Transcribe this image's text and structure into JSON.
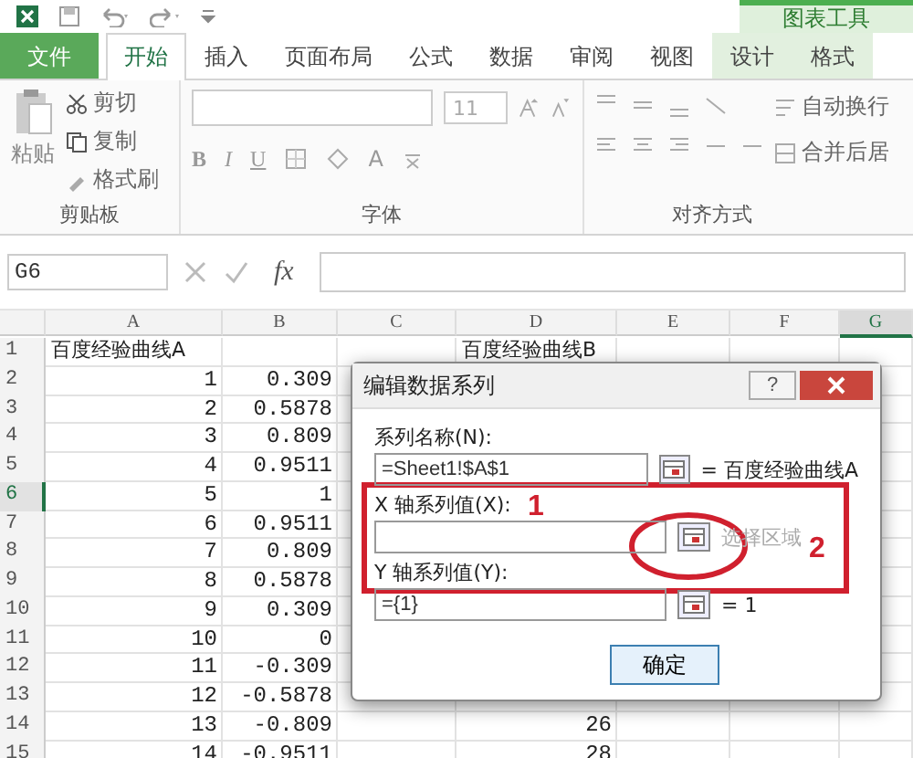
{
  "contextual_tab_group": "图表工具",
  "tabs": [
    {
      "label": "文件",
      "kind": "file",
      "selected": false
    },
    {
      "label": "开始",
      "kind": "normal",
      "selected": true
    },
    {
      "label": "插入",
      "kind": "normal",
      "selected": false
    },
    {
      "label": "页面布局",
      "kind": "normal",
      "selected": false
    },
    {
      "label": "公式",
      "kind": "normal",
      "selected": false
    },
    {
      "label": "数据",
      "kind": "normal",
      "selected": false
    },
    {
      "label": "审阅",
      "kind": "normal",
      "selected": false
    },
    {
      "label": "视图",
      "kind": "normal",
      "selected": false
    },
    {
      "label": "设计",
      "kind": "contextual",
      "selected": false
    },
    {
      "label": "格式",
      "kind": "contextual",
      "selected": false
    }
  ],
  "ribbon": {
    "clipboard": {
      "paste": "粘贴",
      "cut": "剪切",
      "copy": "复制",
      "format_painter": "格式刷",
      "label": "剪贴板"
    },
    "font": {
      "font_size": "11",
      "bold": "B",
      "italic": "I",
      "underline": "U",
      "font_color": "A",
      "label": "字体"
    },
    "alignment": {
      "wrap_text": "自动换行",
      "merge": "合并后居",
      "label": "对齐方式"
    }
  },
  "name_box": "G6",
  "formula_bar": {
    "fx": "fx"
  },
  "sheet": {
    "columns": [
      {
        "label": "A",
        "selected": false
      },
      {
        "label": "B",
        "selected": false
      },
      {
        "label": "C",
        "selected": false
      },
      {
        "label": "D",
        "selected": false
      },
      {
        "label": "E",
        "selected": false
      },
      {
        "label": "F",
        "selected": false
      },
      {
        "label": "G",
        "selected": true
      }
    ],
    "rows": [
      {
        "number": "1",
        "selected": false,
        "cells": [
          "百度经验曲线A",
          "",
          "",
          "百度经验曲线B"
        ]
      },
      {
        "number": "2",
        "selected": false,
        "cells": [
          "1",
          "0.309"
        ]
      },
      {
        "number": "3",
        "selected": false,
        "cells": [
          "2",
          "0.5878"
        ]
      },
      {
        "number": "4",
        "selected": false,
        "cells": [
          "3",
          "0.809"
        ]
      },
      {
        "number": "5",
        "selected": false,
        "cells": [
          "4",
          "0.9511"
        ]
      },
      {
        "number": "6",
        "selected": true,
        "cells": [
          "5",
          "1"
        ]
      },
      {
        "number": "7",
        "selected": false,
        "cells": [
          "6",
          "0.9511"
        ]
      },
      {
        "number": "8",
        "selected": false,
        "cells": [
          "7",
          "0.809"
        ]
      },
      {
        "number": "9",
        "selected": false,
        "cells": [
          "8",
          "0.5878"
        ]
      },
      {
        "number": "10",
        "selected": false,
        "cells": [
          "9",
          "0.309"
        ]
      },
      {
        "number": "11",
        "selected": false,
        "cells": [
          "10",
          "0"
        ]
      },
      {
        "number": "12",
        "selected": false,
        "cells": [
          "11",
          "-0.309"
        ]
      },
      {
        "number": "13",
        "selected": false,
        "cells": [
          "12",
          "-0.5878"
        ]
      },
      {
        "number": "14",
        "selected": false,
        "cells": [
          "13",
          "-0.809",
          "",
          "26"
        ]
      },
      {
        "number": "15",
        "selected": false,
        "cells": [
          "14",
          "-0.9511",
          "",
          "28"
        ]
      }
    ]
  },
  "dialog": {
    "title": "编辑数据系列",
    "help": "?",
    "fields": [
      {
        "label": "系列名称(N):",
        "value": "=Sheet1!$A$1",
        "result": "= 百度经验曲线A",
        "result_muted": false
      },
      {
        "label": "X 轴系列值(X):",
        "result": "选择区域",
        "result_muted": true
      },
      {
        "label": "Y 轴系列值(Y):",
        "value": "={1}",
        "result": "= 1",
        "result_muted": false
      }
    ],
    "annotations": [
      {
        "kind": "frame"
      },
      {
        "kind": "ellipse"
      },
      {
        "kind": "number",
        "text": "1"
      },
      {
        "kind": "number",
        "text": "2"
      }
    ],
    "ok_button": "确定"
  }
}
